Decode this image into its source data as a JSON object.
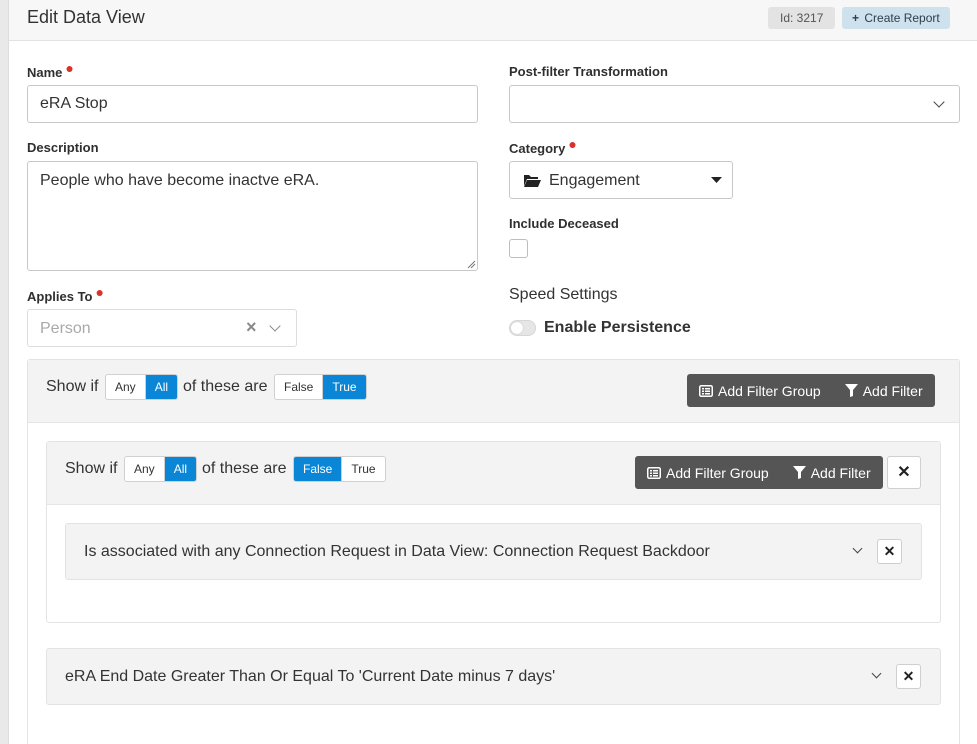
{
  "header": {
    "title": "Edit Data View",
    "id_label": "Id: 3217",
    "create_report": "Create Report"
  },
  "form": {
    "name_label": "Name",
    "name_value": "eRA Stop",
    "description_label": "Description",
    "description_value": "People who have become inactve eRA.",
    "applies_to_label": "Applies To",
    "applies_to_value": "Person",
    "post_filter_label": "Post-filter Transformation",
    "post_filter_value": "",
    "category_label": "Category",
    "category_value": "Engagement",
    "include_deceased_label": "Include Deceased",
    "include_deceased_checked": false,
    "speed_settings_title": "Speed Settings",
    "enable_persistence_label": "Enable Persistence",
    "enable_persistence_on": false
  },
  "outer_group": {
    "show_if": "Show if",
    "any_label": "Any",
    "all_label": "All",
    "match": "All",
    "of_these_are": "of these are",
    "false_label": "False",
    "true_label": "True",
    "truth": "True",
    "add_filter_group": "Add Filter Group",
    "add_filter": "Add Filter"
  },
  "inner_group": {
    "show_if": "Show if",
    "any_label": "Any",
    "all_label": "All",
    "match": "All",
    "of_these_are": "of these are",
    "false_label": "False",
    "true_label": "True",
    "truth": "False",
    "add_filter_group": "Add Filter Group",
    "add_filter": "Add Filter",
    "filters": [
      {
        "text": "Is associated with any Connection Request in Data View: Connection Request Backdoor"
      }
    ]
  },
  "outer_filters": [
    {
      "text": "eRA End Date Greater Than Or Equal To 'Current Date minus 7 days'"
    }
  ],
  "colors": {
    "accent": "#0b86d6",
    "required": "#d9312b",
    "dark_button": "#555555",
    "create_report_bg": "#cde2ec"
  }
}
